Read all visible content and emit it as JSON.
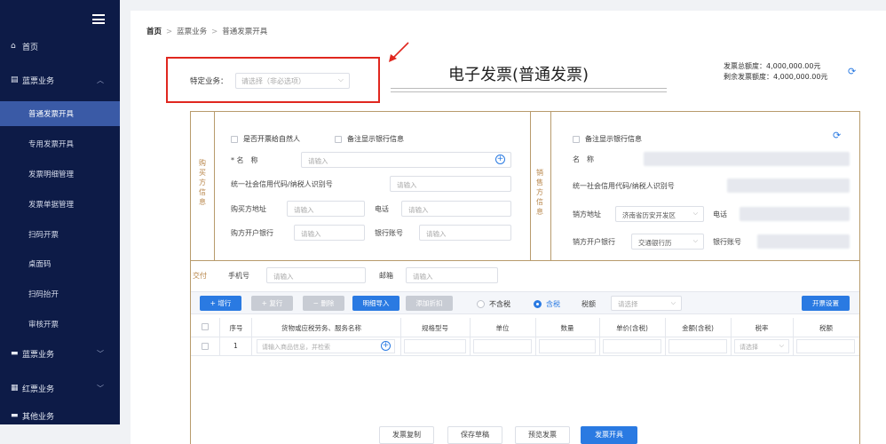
{
  "sidebar": {
    "items": [
      {
        "label": "首页",
        "icon": "home-icon",
        "glyph": "⌂"
      },
      {
        "label": "蓝票业务",
        "icon": "invoice-icon",
        "glyph": "▤"
      },
      {
        "label": "普通发票开具"
      },
      {
        "label": "专用发票开具"
      },
      {
        "label": "发票明细管理"
      },
      {
        "label": "发票单据管理"
      },
      {
        "label": "扫码开票"
      },
      {
        "label": "桌面码"
      },
      {
        "label": "扫码抬开"
      },
      {
        "label": "审核开票"
      },
      {
        "label": "蓝票业务",
        "icon": "card-icon",
        "glyph": "▬"
      },
      {
        "label": "红票业务",
        "icon": "doc-icon",
        "glyph": "▦"
      },
      {
        "label": "其他业务",
        "icon": "more-icon",
        "glyph": "▬"
      }
    ]
  },
  "breadcrumb": [
    "首页",
    "蓝票业务",
    "普通发票开具"
  ],
  "biz": {
    "label": "特定业务：",
    "placeholder": "请选择（非必选项）"
  },
  "title": "电子发票(普通发票)",
  "amounts": {
    "total": "发票总额度：4,000,000.00元",
    "remaining": "剩余发票额度：4,000,000.00元"
  },
  "buyer": {
    "side_label": "购买方信息",
    "check_natural": "是否开票给自然人",
    "check_bank": "备注显示银行信息",
    "name_label": "* 名　称",
    "name_ph": "请输入",
    "credit_label": "统一社会信用代码/纳税人识别号",
    "credit_ph": "请输入",
    "addr_label": "购买方地址",
    "addr_ph": "请输入",
    "phone_label": "电话",
    "phone_ph": "请输入",
    "bank_label": "购方开户银行",
    "bank_ph": "请输入",
    "account_label": "银行账号",
    "account_ph": "请输入"
  },
  "seller": {
    "side_label": "销售方信息",
    "check_bank": "备注显示银行信息",
    "name_label": "名　称",
    "credit_label": "统一社会信用代码/纳税人识别号",
    "addr_label": "销方地址",
    "addr_value": "济南省历安开发区",
    "phone_label": "电话",
    "bank_label": "销方开户银行",
    "bank_value": "交通银行历",
    "account_label": "银行账号"
  },
  "delivery": {
    "label": "交付",
    "phone_label": "手机号",
    "phone_ph": "请输入",
    "email_label": "邮箱",
    "email_ph": "请输入"
  },
  "toolbar": {
    "add": "+ 增行",
    "copy": "+ 复行",
    "delete": "− 删除",
    "import": "明细导入",
    "discount": "添加折扣",
    "tax_excl": "不含税",
    "tax_incl": "含税",
    "rate_label": "税额",
    "rate_ph": "请选择",
    "settings": "开票设置"
  },
  "table": {
    "headers": [
      "序号",
      "货物或应税劳务、服务名称",
      "规格型号",
      "单位",
      "数量",
      "单价(含税)",
      "金额(含税)",
      "税率",
      "税额"
    ],
    "row": {
      "index": "1",
      "name_ph": "请输入商品信息，并检索",
      "rate_ph": "请选择"
    }
  },
  "footer": {
    "copy": "发票复制",
    "save": "保存草稿",
    "preview": "预览发票",
    "issue": "发票开具"
  },
  "colors": {
    "sidebar": "#0d1b47",
    "active": "#3a5aa6",
    "primary": "#2a7ae2",
    "highlight": "#e0271f",
    "panel_border": "#b89b6c"
  }
}
